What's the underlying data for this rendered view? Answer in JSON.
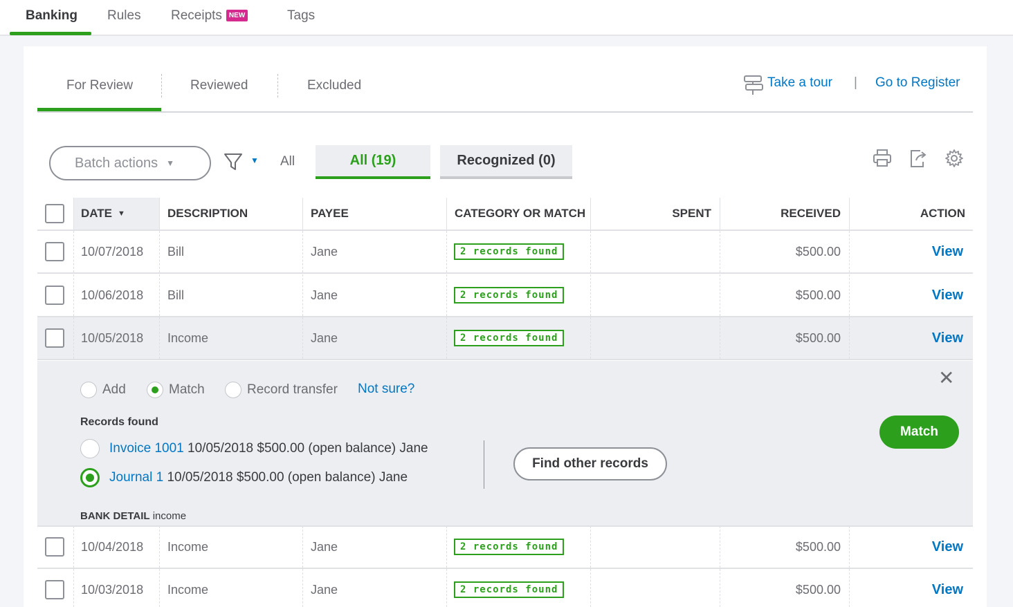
{
  "top_tabs": {
    "banking": "Banking",
    "rules": "Rules",
    "receipts": "Receipts",
    "receipts_badge": "NEW",
    "tags": "Tags"
  },
  "sub_tabs": {
    "for_review": "For Review",
    "reviewed": "Reviewed",
    "excluded": "Excluded"
  },
  "links": {
    "take_tour": "Take a tour",
    "separator": "|",
    "go_to_register": "Go to Register"
  },
  "toolbar": {
    "batch_actions": "Batch actions",
    "all_label": "All",
    "all_segment": "All (19)",
    "recognized_segment": "Recognized (0)"
  },
  "table": {
    "headers": {
      "date": "DATE",
      "description": "DESCRIPTION",
      "payee": "PAYEE",
      "category": "CATEGORY OR MATCH",
      "spent": "SPENT",
      "received": "RECEIVED",
      "action": "ACTION"
    },
    "rows": [
      {
        "date": "10/07/2018",
        "description": "Bill",
        "payee": "Jane",
        "category": "2 records found",
        "spent": "",
        "received": "$500.00",
        "action": "View"
      },
      {
        "date": "10/06/2018",
        "description": "Bill",
        "payee": "Jane",
        "category": "2 records found",
        "spent": "",
        "received": "$500.00",
        "action": "View"
      },
      {
        "date": "10/05/2018",
        "description": "Income",
        "payee": "Jane",
        "category": "2 records found",
        "spent": "",
        "received": "$500.00",
        "action": "View"
      },
      {
        "date": "10/04/2018",
        "description": "Income",
        "payee": "Jane",
        "category": "2 records found",
        "spent": "",
        "received": "$500.00",
        "action": "View"
      },
      {
        "date": "10/03/2018",
        "description": "Income",
        "payee": "Jane",
        "category": "2 records found",
        "spent": "",
        "received": "$500.00",
        "action": "View"
      }
    ]
  },
  "panel": {
    "option_add": "Add",
    "option_match": "Match",
    "option_transfer": "Record transfer",
    "not_sure": "Not sure?",
    "selected_option": "Match",
    "records_title": "Records found",
    "records": [
      {
        "link": "Invoice 1001",
        "detail": "10/05/2018 $500.00 (open balance) Jane",
        "selected": false
      },
      {
        "link": "Journal 1",
        "detail": "10/05/2018 $500.00 (open balance) Jane",
        "selected": true
      }
    ],
    "find_other": "Find other records",
    "match_button": "Match",
    "bank_detail_label": "BANK DETAIL",
    "bank_detail_value": "income"
  },
  "colors": {
    "accent_green": "#2ca01c",
    "link_blue": "#0077c5",
    "badge_pink": "#d52b8f"
  }
}
